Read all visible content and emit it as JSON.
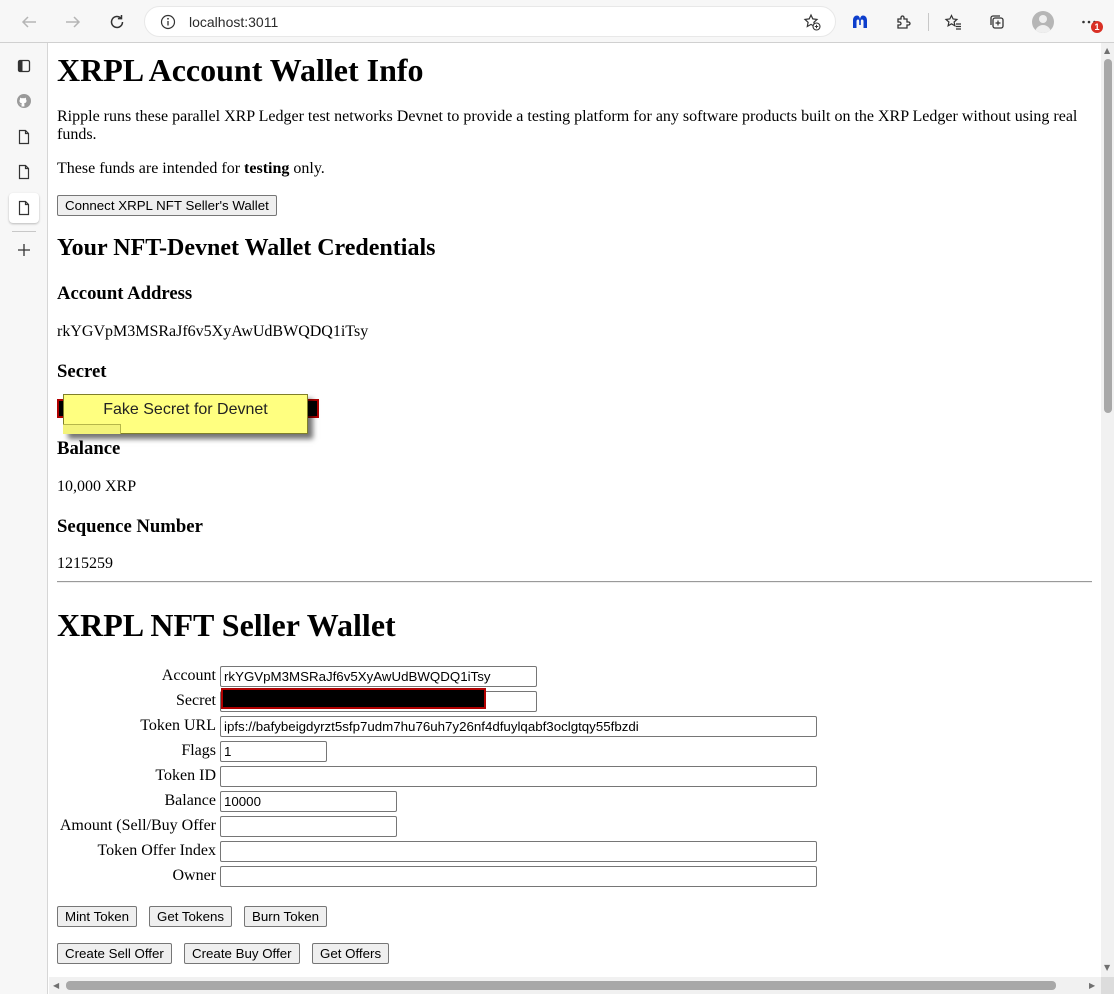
{
  "browser": {
    "url": "localhost:3011",
    "notification_count": "1"
  },
  "page": {
    "title": "XRPL Account Wallet Info",
    "intro": "Ripple runs these parallel XRP Ledger test networks Devnet to provide a testing platform for any software products built on the XRP Ledger without using real funds.",
    "funds_note_pre": "These funds are intended for ",
    "funds_note_bold": "testing",
    "funds_note_post": " only.",
    "connect_button": "Connect XRPL NFT Seller's Wallet",
    "credentials_heading": "Your NFT-Devnet Wallet Credentials",
    "account_address_label": "Account Address",
    "account_address": "rkYGVpM3MSRaJf6v5XyAwUdBWQDQ1iTsy",
    "secret_label": "Secret",
    "secret_note": "Fake Secret for Devnet",
    "balance_label": "Balance",
    "balance": "10,000 XRP",
    "sequence_label": "Sequence Number",
    "sequence": "1215259"
  },
  "seller": {
    "heading": "XRPL NFT Seller Wallet",
    "fields": {
      "account_label": "Account",
      "account_value": "rkYGVpM3MSRaJf6v5XyAwUdBWQDQ1iTsy",
      "secret_label": "Secret",
      "token_url_label": "Token URL",
      "token_url_value": "ipfs://bafybeigdyrzt5sfp7udm7hu76uh7y26nf4dfuylqabf3oclgtqy55fbzdi",
      "flags_label": "Flags",
      "flags_value": "1",
      "token_id_label": "Token ID",
      "balance_label": "Balance",
      "balance_value": "10000",
      "amount_label": "Amount (Sell/Buy Offer",
      "token_offer_index_label": "Token Offer Index",
      "owner_label": "Owner"
    },
    "buttons": {
      "mint": "Mint Token",
      "get_tokens": "Get Tokens",
      "burn": "Burn Token",
      "create_sell": "Create Sell Offer",
      "create_buy": "Create Buy Offer",
      "get_offers": "Get Offers"
    }
  },
  "colors": {
    "sticky_note": "#ffff80",
    "redaction": "#000000",
    "redaction_border": "#b00000"
  },
  "icons": [
    "back-icon",
    "forward-icon",
    "refresh-icon",
    "info-icon",
    "add-favorite-icon",
    "malwarebytes-icon",
    "extensions-icon",
    "favorites-icon",
    "collections-icon",
    "profile-icon",
    "more-icon",
    "tab-actions-icon",
    "github-icon",
    "page-icon",
    "add-icon"
  ]
}
